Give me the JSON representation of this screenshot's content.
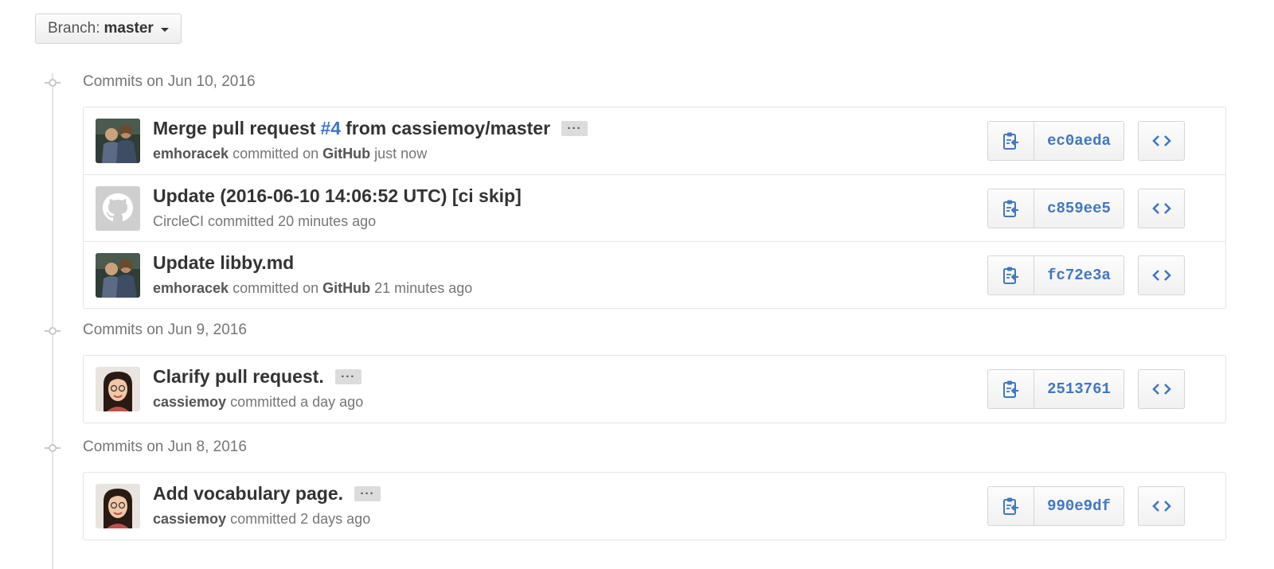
{
  "branch": {
    "label": "Branch:",
    "name": "master"
  },
  "colors": {
    "link": "#4078c0",
    "muted": "#767676",
    "border": "#e5e5e5"
  },
  "groups": [
    {
      "title": "Commits on Jun 10, 2016",
      "commits": [
        {
          "title_before": "Merge pull request",
          "issue": "#4",
          "title_after": "from cassiemoy/master",
          "has_ellipsis": true,
          "ellipsis": "···",
          "author": "emhoracek",
          "committed_text": "committed on",
          "committer": "GitHub",
          "time": "just now",
          "avatar": "photo-two-people-icon",
          "sha": "ec0aeda"
        },
        {
          "title": "Update (2016-06-10 14:06:52 UTC) [ci skip]",
          "author": "CircleCI",
          "committed_text": "committed",
          "time": "20 minutes ago",
          "avatar": "octocat-icon",
          "sha": "c859ee5"
        },
        {
          "title": "Update libby.md",
          "author": "emhoracek",
          "committed_text": "committed on",
          "committer": "GitHub",
          "time": "21 minutes ago",
          "avatar": "photo-two-people-icon",
          "sha": "fc72e3a"
        }
      ]
    },
    {
      "title": "Commits on Jun 9, 2016",
      "commits": [
        {
          "title": "Clarify pull request.",
          "has_ellipsis": true,
          "ellipsis": "···",
          "author": "cassiemoy",
          "committed_text": "committed",
          "time": "a day ago",
          "avatar": "photo-portrait-icon",
          "sha": "2513761"
        }
      ]
    },
    {
      "title": "Commits on Jun 8, 2016",
      "commits": [
        {
          "title": "Add vocabulary page.",
          "has_ellipsis": true,
          "ellipsis": "···",
          "author": "cassiemoy",
          "committed_text": "committed",
          "time": "2 days ago",
          "avatar": "photo-portrait-icon",
          "sha": "990e9df"
        }
      ]
    }
  ]
}
